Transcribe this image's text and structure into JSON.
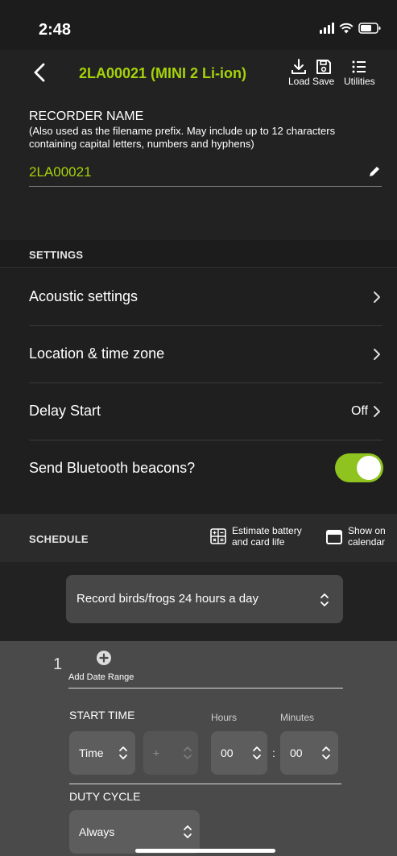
{
  "status_bar": {
    "time": "2:48"
  },
  "nav": {
    "title": "2LA00021 (MINI 2 Li-ion)",
    "load_label": "Load",
    "save_label": "Save",
    "utilities_label": "Utilities"
  },
  "recorder": {
    "label": "RECORDER NAME",
    "hint": "(Also used as the filename prefix. May include up to 12 characters containing capital letters, numbers and hyphens)",
    "value": "2LA00021"
  },
  "settings": {
    "title": "SETTINGS",
    "items": [
      {
        "label": "Acoustic settings"
      },
      {
        "label": "Location & time zone"
      },
      {
        "label": "Delay Start",
        "value": "Off"
      },
      {
        "label": "Send Bluetooth beacons?",
        "toggle_on": true
      }
    ]
  },
  "schedule": {
    "title": "SCHEDULE",
    "estimate_line1": "Estimate battery",
    "estimate_line2": "and card life",
    "calendar_line1": "Show on",
    "calendar_line2": "calendar",
    "preset": "Record birds/frogs 24 hours a day"
  },
  "period": {
    "number": "1",
    "add_date_range": "Add Date Range",
    "start_time_label": "START TIME",
    "hours_label": "Hours",
    "minutes_label": "Minutes",
    "time_select": "Time",
    "offset_sign": "+",
    "hours_value": "00",
    "separator": ":",
    "minutes_value": "00",
    "duty_cycle_label": "DUTY CYCLE",
    "duty_cycle_value": "Always"
  },
  "colors": {
    "accent": "#a5d20a",
    "toggle_on": "#8fc31f",
    "background": "#1f1f1f",
    "panel": "#4a4a4a"
  }
}
